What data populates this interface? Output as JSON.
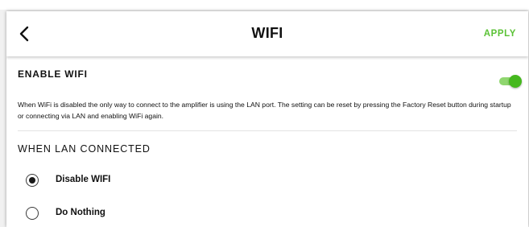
{
  "header": {
    "back_icon": "chevron-left-icon",
    "title": "WIFI",
    "apply_label": "APPLY"
  },
  "colors": {
    "accent": "#5bc236",
    "toggle_on": "#45b81e"
  },
  "enable_wifi": {
    "title": "ENABLE WIFI",
    "enabled": true,
    "description": "When WiFi is disabled the only way to connect to the amplifier is using the LAN port. The setting can be reset by pressing the Factory Reset button during startup or connecting via LAN and enabling WiFi again."
  },
  "lan_connected": {
    "title": "WHEN LAN CONNECTED",
    "selected": "Disable WIFI",
    "options": [
      {
        "label": "Disable WIFI"
      },
      {
        "label": "Do Nothing"
      }
    ]
  }
}
